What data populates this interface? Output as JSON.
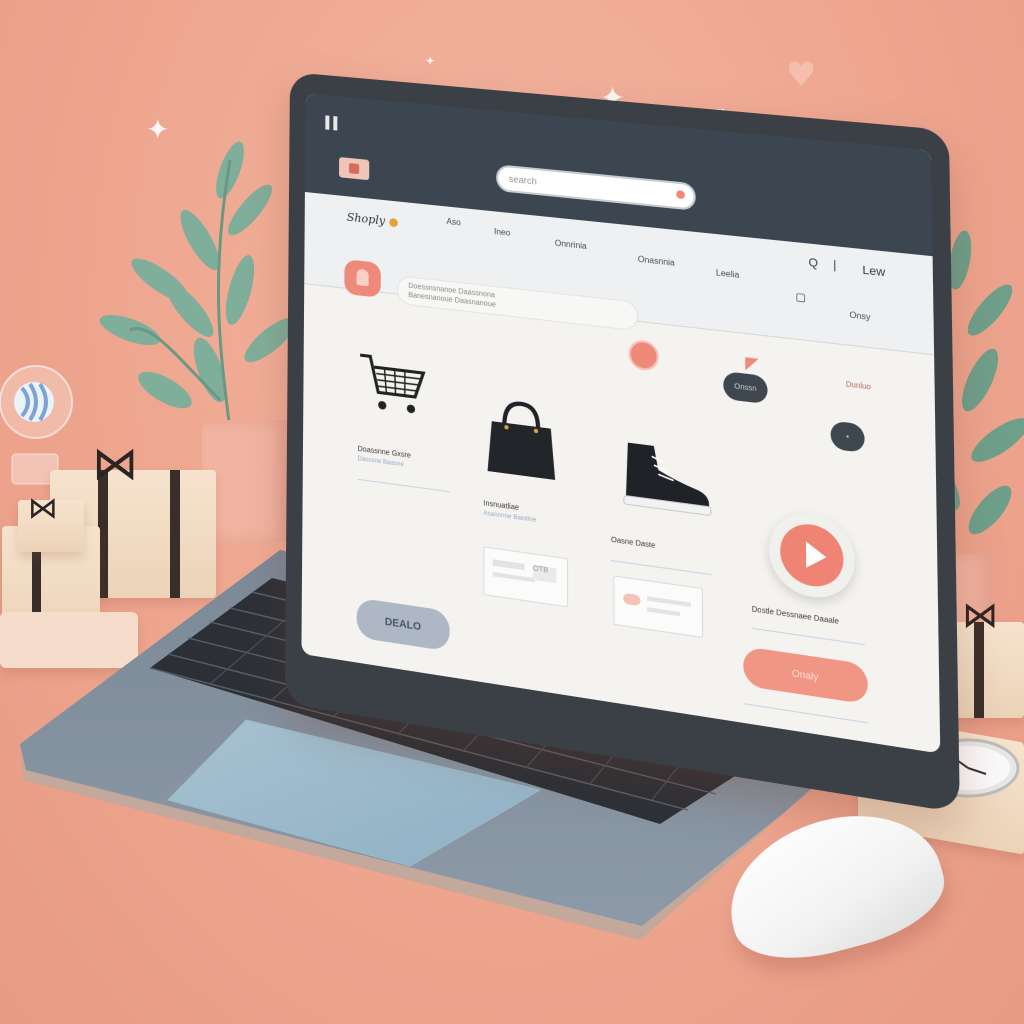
{
  "colors": {
    "background": "#eea68f",
    "header": "#3c4650",
    "accent": "#ef8a7a",
    "screen": "#f4f3ef"
  },
  "header": {
    "brand": "Shoply",
    "search_placeholder": "search"
  },
  "nav": {
    "items": [
      "Aso",
      "Ineo",
      "Onnrinia",
      "Onasnnia",
      "Leelia"
    ],
    "right_icons": [
      "search-icon",
      "menu-icon"
    ],
    "right_label": "Lew",
    "account_label": "Onsy"
  },
  "hero": {
    "search_line1": "Doessnsnanoe Daassnona",
    "search_line2": "Banesnanoue Daasnanoue"
  },
  "cards": {
    "pill_top": "Onssn",
    "tag": "Dunluo",
    "cart_label": "Doassnne Gxsre",
    "cart_sub": "Dasssne Baasne",
    "bag_label": "Insnuatliae",
    "bag_sub": "Asasnnne Baiotlne",
    "shoe_label": "Oasne Daste",
    "video_label": "Dostle Dessnaee Daaale",
    "gray_button": "DEALO",
    "coral_button": "Onaly",
    "thumb_text": "OTB"
  },
  "icons": {
    "cart": "shopping-cart-icon",
    "bag": "handbag-icon",
    "shoe": "sneaker-icon",
    "play": "play-icon",
    "user": "user-icon"
  }
}
